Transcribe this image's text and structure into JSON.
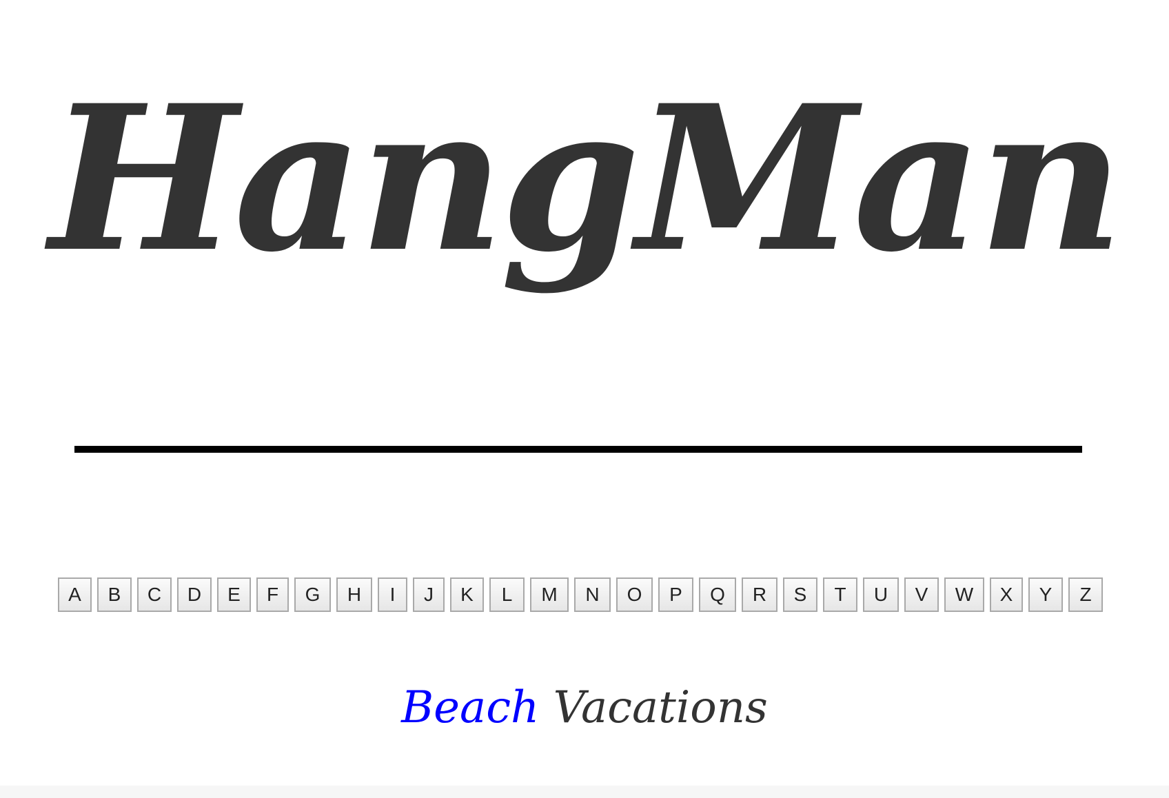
{
  "title": "HangMan",
  "letters": [
    "A",
    "B",
    "C",
    "D",
    "E",
    "F",
    "G",
    "H",
    "I",
    "J",
    "K",
    "L",
    "M",
    "N",
    "O",
    "P",
    "Q",
    "R",
    "S",
    "T",
    "U",
    "V",
    "W",
    "X",
    "Y",
    "Z"
  ],
  "category": {
    "word1": "Beach",
    "word2": "Vacations"
  },
  "colors": {
    "title": "#333333",
    "hint": "#0000ff",
    "line": "#000000"
  }
}
